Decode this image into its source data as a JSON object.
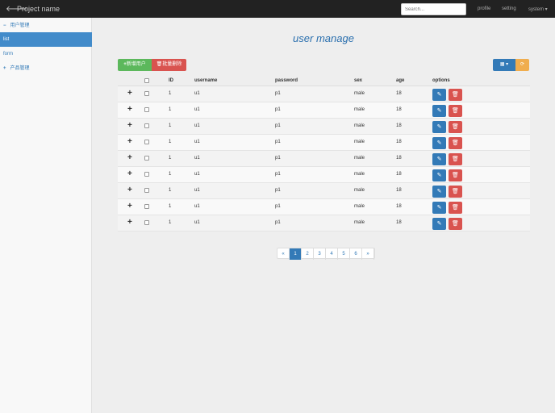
{
  "navbar": {
    "brand": "Project name",
    "search_placeholder": "Search...",
    "links": [
      "profile",
      "setting",
      "system ▾"
    ]
  },
  "sidebar": {
    "items": [
      {
        "label": "用户管理",
        "sym": "−"
      },
      {
        "label": "list"
      },
      {
        "label": "form"
      },
      {
        "label": "产品管理",
        "sym": "+"
      }
    ]
  },
  "page_title": "user manage",
  "toolbar": {
    "add_label": "新增用户",
    "batch_delete_label": "批量删除"
  },
  "table": {
    "headers": [
      "ID",
      "username",
      "password",
      "sex",
      "age",
      "options"
    ],
    "rows": [
      [
        "1",
        "u1",
        "p1",
        "male",
        "18"
      ],
      [
        "1",
        "u1",
        "p1",
        "male",
        "18"
      ],
      [
        "1",
        "u1",
        "p1",
        "male",
        "18"
      ],
      [
        "1",
        "u1",
        "p1",
        "male",
        "18"
      ],
      [
        "1",
        "u1",
        "p1",
        "male",
        "18"
      ],
      [
        "1",
        "u1",
        "p1",
        "male",
        "18"
      ],
      [
        "1",
        "u1",
        "p1",
        "male",
        "18"
      ],
      [
        "1",
        "u1",
        "p1",
        "male",
        "18"
      ],
      [
        "1",
        "u1",
        "p1",
        "male",
        "18"
      ]
    ]
  },
  "pagination": {
    "pages": [
      "«",
      "1",
      "2",
      "3",
      "4",
      "5",
      "6",
      "»"
    ],
    "current": "1"
  },
  "colors": {
    "primary": "#337ab7",
    "success": "#5cb85c",
    "danger": "#d9534f",
    "warning": "#f0ad4e"
  }
}
